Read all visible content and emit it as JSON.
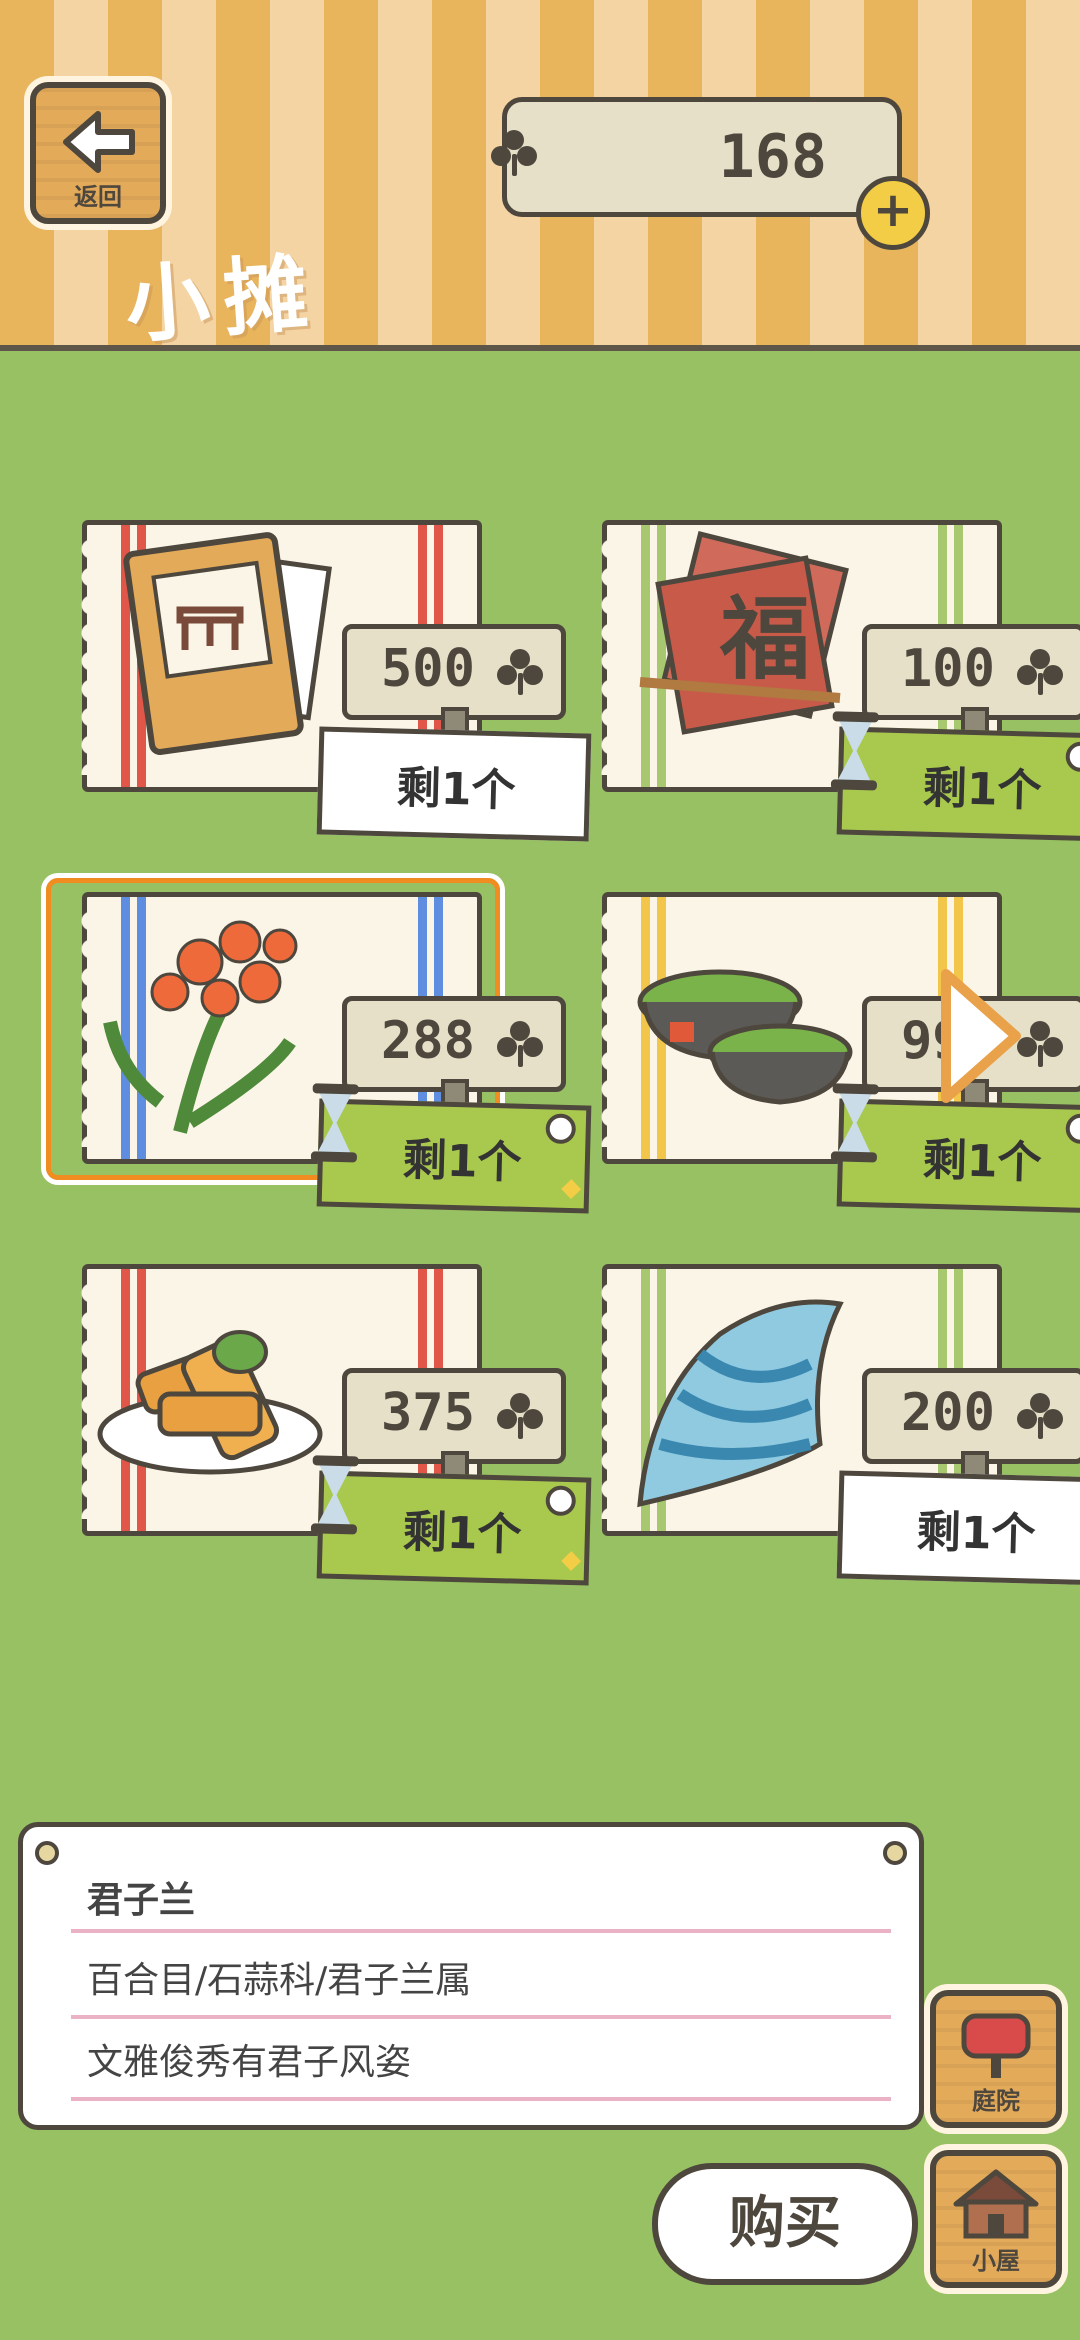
{
  "header": {
    "back_label": "返回",
    "title": "小摊",
    "currency": {
      "value": "168",
      "icon": "clover-icon"
    },
    "add_icon": "plus-icon"
  },
  "items": [
    {
      "price": "500",
      "stock": "剩1个",
      "limited": false,
      "art": "book-cover",
      "stripe": "#e0574a"
    },
    {
      "price": "100",
      "stock": "剩1个",
      "limited": true,
      "art": "calligraphy-paper",
      "stripe": "#a8c870"
    },
    {
      "price": "288",
      "stock": "剩1个",
      "limited": true,
      "art": "clivia-flower",
      "stripe": "#5f8ee0",
      "selected": true
    },
    {
      "price": "998",
      "stock": "剩1个",
      "limited": true,
      "art": "moss-pot",
      "stripe": "#f2c64a"
    },
    {
      "price": "375",
      "stock": "剩1个",
      "limited": true,
      "art": "spring-rolls",
      "stripe": "#e0574a"
    },
    {
      "price": "200",
      "stock": "剩1个",
      "limited": false,
      "art": "seashell",
      "stripe": "#a8c870"
    }
  ],
  "info": {
    "name": "君子兰",
    "classification": "百合目/石蒜科/君子兰属",
    "description": "文雅俊秀有君子风姿"
  },
  "buttons": {
    "buy": "购买",
    "yard": "庭院",
    "house": "小屋"
  },
  "colors": {
    "header_orange": "#e8b45c",
    "grass": "#97c162",
    "select_orange": "#f08c20"
  }
}
